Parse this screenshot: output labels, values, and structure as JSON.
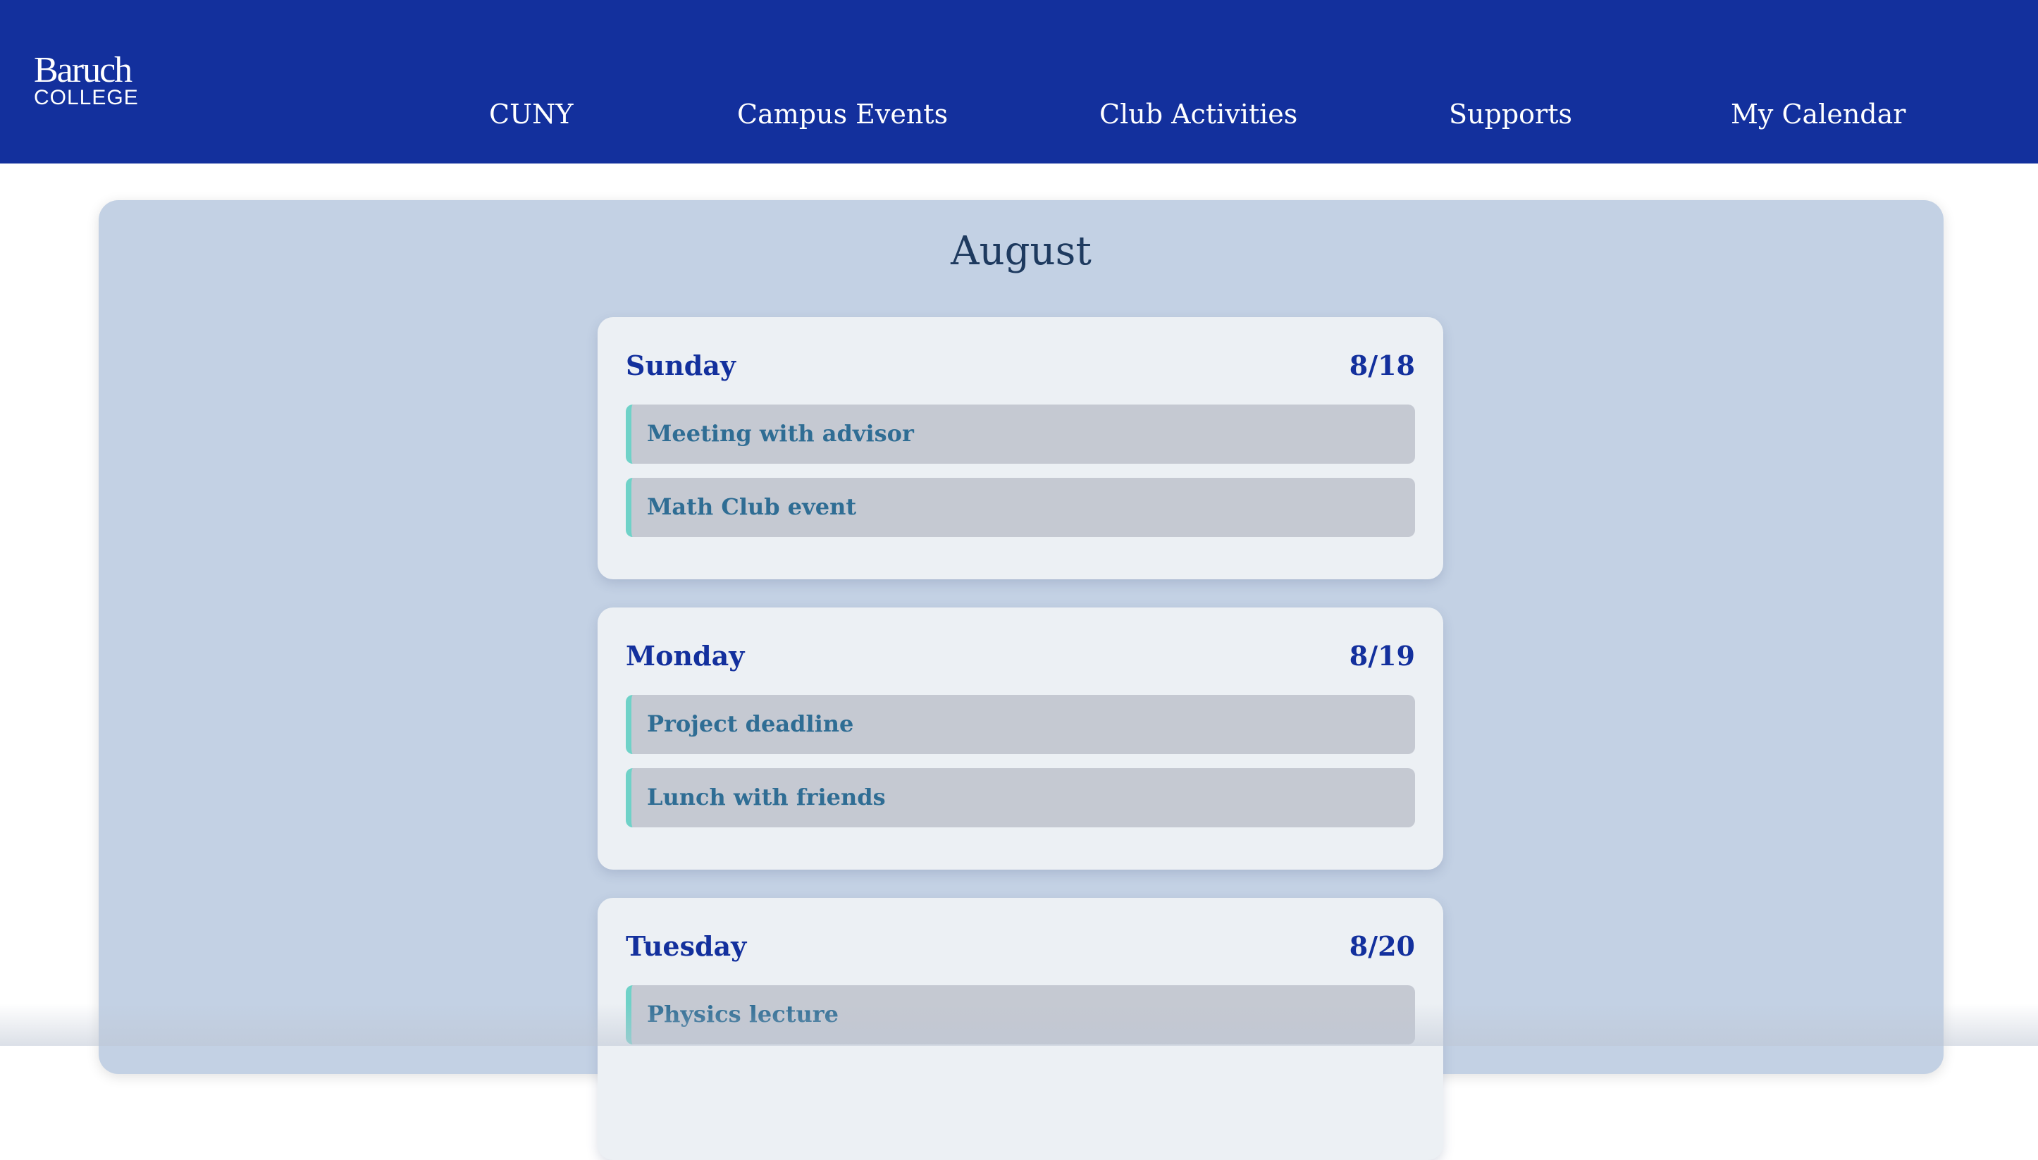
{
  "header": {
    "logo_main": "Baruch",
    "logo_sub": "COLLEGE",
    "nav": [
      {
        "label": "CUNY"
      },
      {
        "label": "Campus Events"
      },
      {
        "label": "Club Activities"
      },
      {
        "label": "Supports"
      },
      {
        "label": "My Calendar"
      }
    ]
  },
  "calendar": {
    "month": "August",
    "days": [
      {
        "name": "Sunday",
        "date": "8/18",
        "events": [
          {
            "label": "Meeting with advisor"
          },
          {
            "label": "Math Club event"
          }
        ]
      },
      {
        "name": "Monday",
        "date": "8/19",
        "events": [
          {
            "label": "Project deadline"
          },
          {
            "label": "Lunch with friends"
          }
        ]
      },
      {
        "name": "Tuesday",
        "date": "8/20",
        "events": [
          {
            "label": "Physics lecture"
          }
        ]
      }
    ]
  },
  "colors": {
    "header_bg": "#13309d",
    "panel_bg": "#c3d1e4",
    "card_bg": "#ecf0f4",
    "event_bg": "#c5c9d2",
    "event_accent": "#6fd2c8",
    "event_text": "#2f6d94",
    "day_text": "#13309d",
    "month_text": "#1e3a5f"
  }
}
